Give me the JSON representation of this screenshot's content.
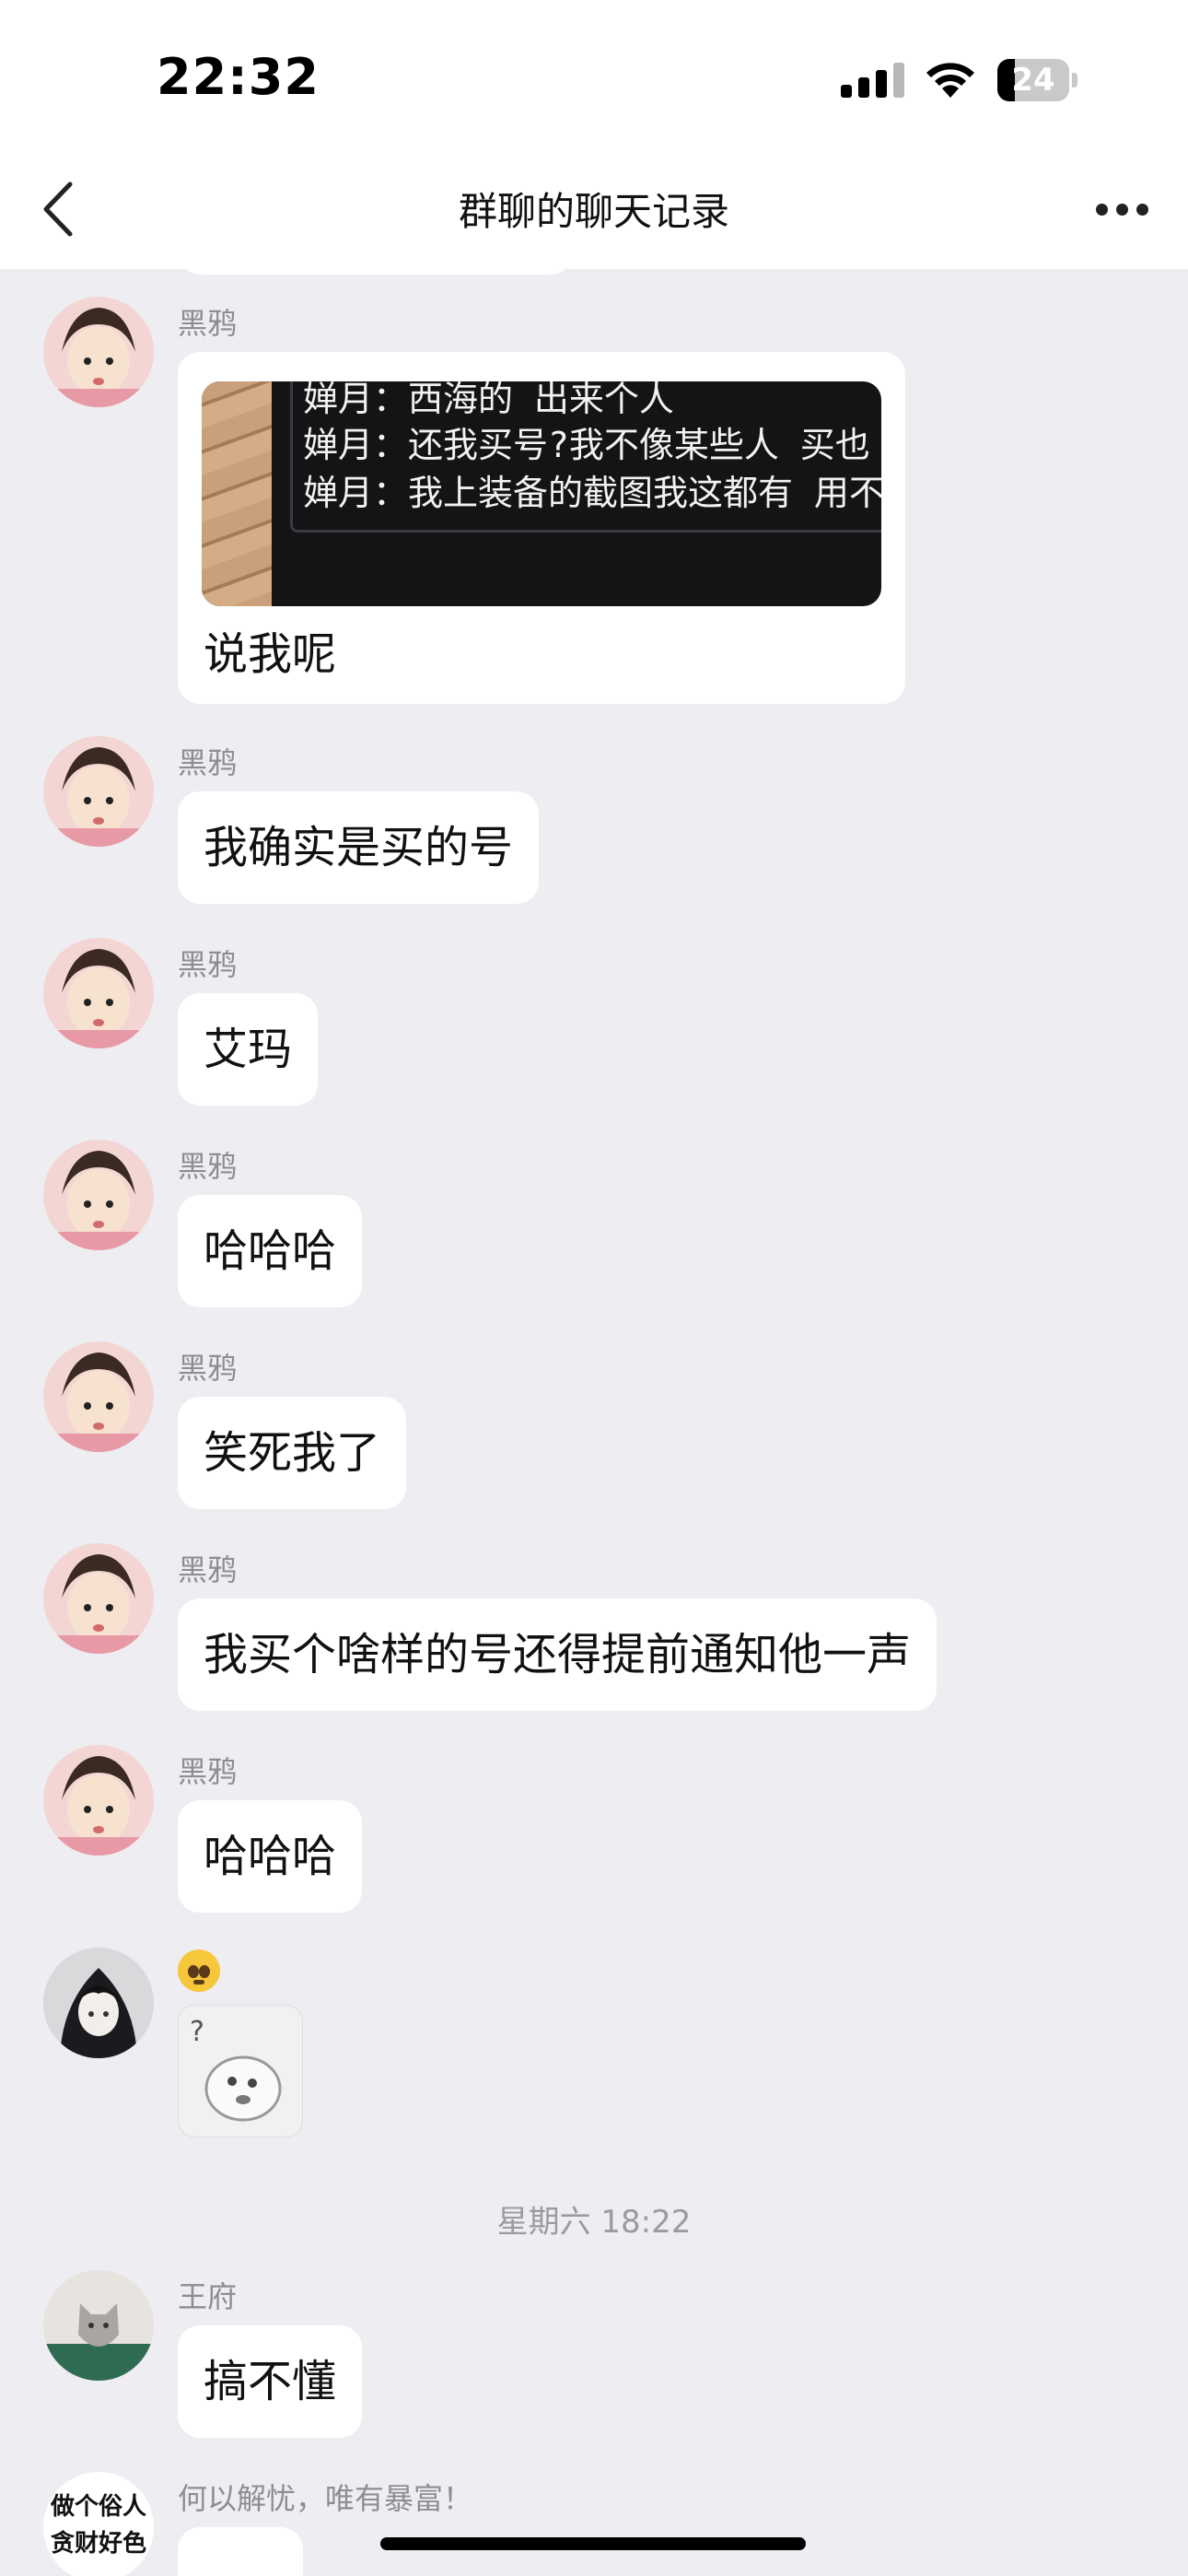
{
  "status_bar": {
    "time": "22:32",
    "battery": "24",
    "battery_level": 0.24
  },
  "nav": {
    "title": "群聊的聊天记录",
    "back_icon": "chevron-left-icon",
    "more_icon": "ellipsis-icon"
  },
  "messages": [
    {
      "sender": "黑鸦",
      "image_lines": [
        "婵月：西海的 出来个人",
        "婵月：还我买号?我不像某些人 买也",
        "婵月：我上装备的截图我这都有 用不"
      ],
      "text": "说我呢"
    },
    {
      "sender": "黑鸦",
      "text": "我确实是买的号"
    },
    {
      "sender": "黑鸦",
      "text": "艾玛"
    },
    {
      "sender": "黑鸦",
      "text": "哈哈哈"
    },
    {
      "sender": "黑鸦",
      "text": "笑死我了"
    },
    {
      "sender": "黑鸦",
      "text": "我买个啥样的号还得提前通知他一声"
    },
    {
      "sender": "黑鸦",
      "text": "哈哈哈"
    },
    {
      "sender_icon": "pleading-face-emoji",
      "sticker": "question-face-sticker"
    },
    {
      "timestamp": "星期六 18:22"
    },
    {
      "sender": "王府",
      "text": "搞不懂"
    },
    {
      "sender": "何以解忧，唯有暴富！",
      "avatar_text": "做个俗人 贪财好色"
    }
  ],
  "colors": {
    "background": "#ededf2",
    "bubble": "#ffffff",
    "name": "#8d8d92"
  }
}
